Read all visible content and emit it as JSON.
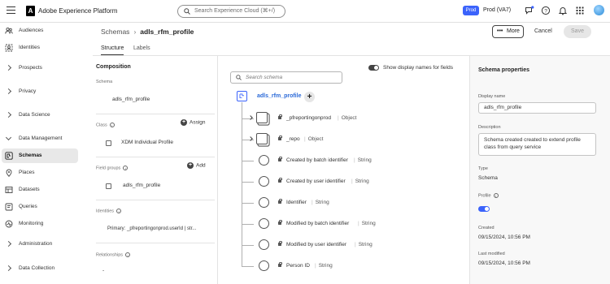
{
  "app": {
    "name": "Adobe Experience Platform",
    "logo_letter": "A"
  },
  "topbar": {
    "search_placeholder": "Search Experience Cloud (⌘+/)",
    "org_badge": "Prod",
    "org_name": "Prod (VA7)",
    "icons": [
      "hamburger-icon",
      "feedback-icon",
      "help-icon",
      "bell-icon",
      "apps-grid-icon",
      "avatar"
    ]
  },
  "sidebar": {
    "items": [
      {
        "label": "Audiences",
        "icon": "audiences-icon",
        "type": "icon"
      },
      {
        "label": "Identities",
        "icon": "identities-icon",
        "type": "icon"
      },
      {
        "label": "Prospects",
        "type": "chevron-right"
      },
      {
        "label": "Privacy",
        "type": "chevron-right"
      },
      {
        "label": "Data Science",
        "type": "chevron-right"
      },
      {
        "label": "Data Management",
        "type": "chevron-down"
      },
      {
        "label": "Schemas",
        "icon": "schemas-icon",
        "type": "icon",
        "selected": true
      },
      {
        "label": "Places",
        "icon": "places-icon",
        "type": "icon"
      },
      {
        "label": "Datasets",
        "icon": "datasets-icon",
        "type": "icon"
      },
      {
        "label": "Queries",
        "icon": "queries-icon",
        "type": "icon"
      },
      {
        "label": "Monitoring",
        "icon": "monitoring-icon",
        "type": "icon"
      },
      {
        "label": "Administration",
        "type": "chevron-right"
      },
      {
        "label": "Data Collection",
        "type": "chevron-right"
      }
    ]
  },
  "header": {
    "breadcrumb_parent": "Schemas",
    "breadcrumb_current": "adls_rfm_profile",
    "more_label": "More",
    "more_dots": "•••",
    "cancel_label": "Cancel",
    "save_label": "Save"
  },
  "tabs": [
    {
      "label": "Structure",
      "active": true
    },
    {
      "label": "Labels",
      "active": false
    }
  ],
  "composition": {
    "title": "Composition",
    "schema_label": "Schema",
    "schema_value": "adls_rfm_profile",
    "class_label": "Class",
    "assign_label": "Assign",
    "class_value": "XDM Individual Profile",
    "field_groups_label": "Field groups",
    "add_label": "Add",
    "field_group_value": "adls_rfm_profile",
    "identities_label": "Identities",
    "identities_value": "Primary: _pfreportingonprod.userId | str...",
    "relationships_label": "Relationships",
    "relationships_value": "-"
  },
  "canvas": {
    "display_names_label": "Show display names for fields",
    "display_names_on": true,
    "search_placeholder": "Search schema",
    "root_name": "adls_rfm_profile",
    "fields": [
      {
        "name": "_pfreportingonprod",
        "type": "Object",
        "kind": "object"
      },
      {
        "name": "_repo",
        "type": "Object",
        "kind": "object"
      },
      {
        "name": "Created by batch identifier",
        "type": "String",
        "kind": "leaf"
      },
      {
        "name": "Created by user identifier",
        "type": "String",
        "kind": "leaf"
      },
      {
        "name": "Identifier",
        "type": "String",
        "kind": "leaf"
      },
      {
        "name": "Modified by batch identifier",
        "type": "String",
        "kind": "leaf"
      },
      {
        "name": "Modified by user identifier",
        "type": "String",
        "kind": "leaf"
      },
      {
        "name": "Person ID",
        "type": "String",
        "kind": "leaf"
      }
    ]
  },
  "properties": {
    "title": "Schema properties",
    "display_name_label": "Display name",
    "display_name_value": "adls_rfm_profile",
    "description_label": "Description",
    "description_value": "Schema created created to extend profile class from query service",
    "type_label": "Type",
    "type_value": "Schema",
    "profile_label": "Profile",
    "profile_enabled": true,
    "created_label": "Created",
    "created_value": "09/15/2024, 10:56 PM",
    "modified_label": "Last modified",
    "modified_value": "09/15/2024, 10:56 PM"
  },
  "colors": {
    "accent": "#3b63fb",
    "link": "#2b6ad8",
    "selected_bg": "#e8e8e8"
  }
}
